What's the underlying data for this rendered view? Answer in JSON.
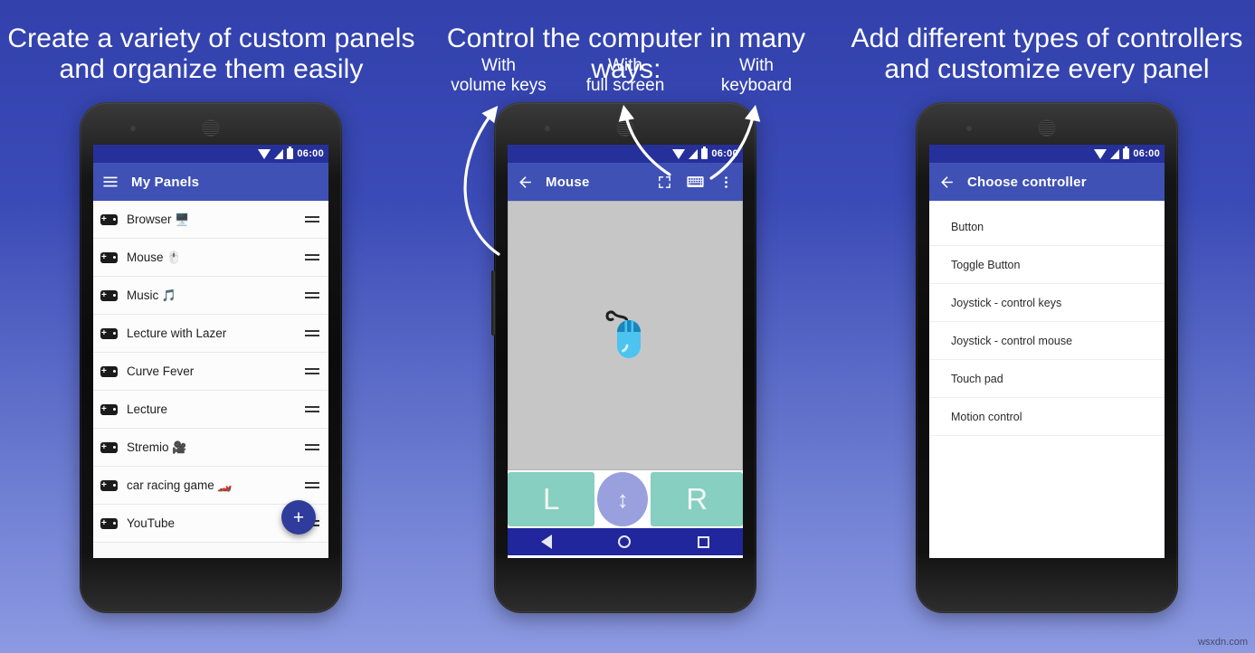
{
  "headlines": {
    "left": "Create a variety of custom panels\nand organize them easily",
    "center": "Control the computer in many ways:",
    "right": "Add different types of controllers\nand customize every panel"
  },
  "sublabels": {
    "volume": "With\nvolume keys",
    "fullscreen": "With\nfull screen",
    "keyboard": "With\nkeyboard"
  },
  "statusbar": {
    "time": "06:00"
  },
  "phone1": {
    "appbar": {
      "title": "My Panels",
      "menu_icon": "hamburger-icon"
    },
    "rows": [
      {
        "label": "Browser",
        "emoji": "🖥️"
      },
      {
        "label": "Mouse",
        "emoji": "🖱️"
      },
      {
        "label": "Music",
        "emoji": "🎵"
      },
      {
        "label": "Lecture with Lazer",
        "emoji": ""
      },
      {
        "label": "Curve Fever",
        "emoji": ""
      },
      {
        "label": "Lecture",
        "emoji": ""
      },
      {
        "label": "Stremio",
        "emoji": "🎥"
      },
      {
        "label": "car racing game",
        "emoji": "🏎️"
      },
      {
        "label": "YouTube",
        "emoji": ""
      }
    ],
    "fab_label": "+"
  },
  "phone2": {
    "appbar": {
      "title": "Mouse",
      "back_icon": "back-arrow-icon",
      "fullscreen_icon": "fullscreen-icon",
      "keyboard_icon": "keyboard-icon",
      "overflow_icon": "overflow-menu-icon"
    },
    "touchpad": {
      "icon": "mouse-icon"
    },
    "buttons": {
      "left": "L",
      "right": "R",
      "scroll": "↕"
    }
  },
  "phone3": {
    "appbar": {
      "title": "Choose controller",
      "back_icon": "back-arrow-icon"
    },
    "options": [
      "Button",
      "Toggle Button",
      "Joystick - control keys",
      "Joystick - control mouse",
      "Touch pad",
      "Motion control"
    ]
  },
  "navbar": {
    "back": "nav-back-icon",
    "home": "nav-home-icon",
    "recent": "nav-recent-icon"
  },
  "watermark": "wsxdn.com",
  "colors": {
    "bg_top": "#3241ac",
    "bg_bottom": "#8c9ae2",
    "appbar": "#3f51b5",
    "statusbar": "#26309a",
    "navbar": "#21269c",
    "fab": "#2f3c9c",
    "mouse_button": "#87cfc1",
    "scroll_button": "#9aa0de",
    "touchpad": "#c6c6c6"
  }
}
